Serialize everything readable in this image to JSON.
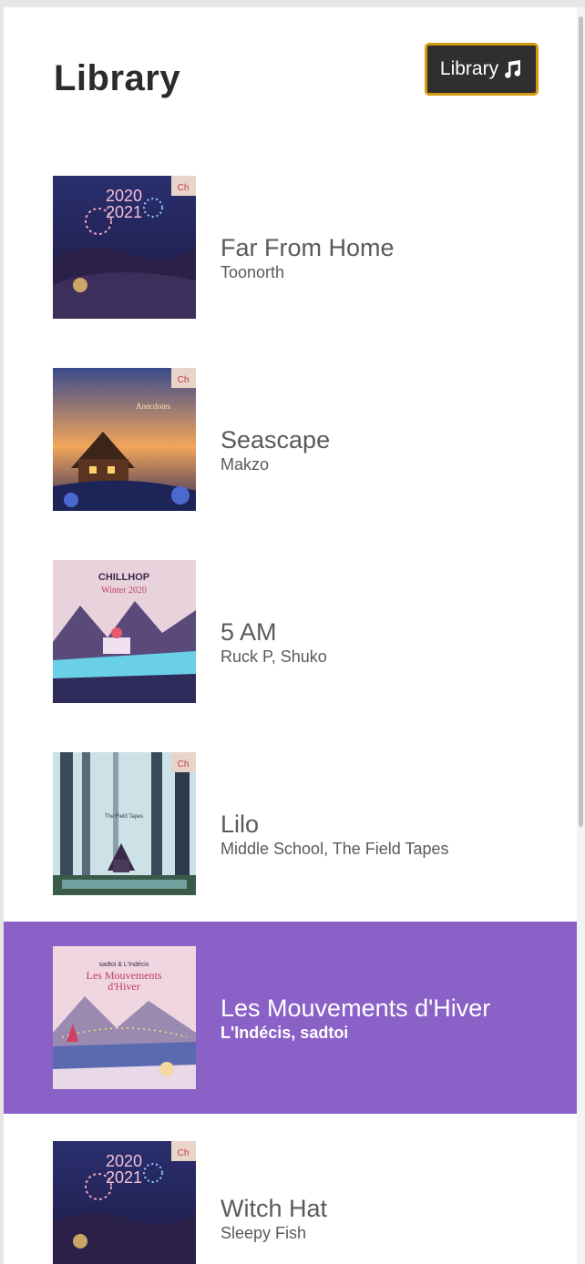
{
  "header": {
    "title": "Library",
    "library_button_label": "Library",
    "library_button_icon": "music-note-icon"
  },
  "colors": {
    "selected_row": "#8a61c6",
    "button_border": "#d59a10",
    "button_bg": "#2f2f2f",
    "text": "#5a5a5a"
  },
  "songs": [
    {
      "title": "Far From Home",
      "artist": "Toonorth",
      "selected": false
    },
    {
      "title": "Seascape",
      "artist": "Makzo",
      "selected": false
    },
    {
      "title": "5 AM",
      "artist": "Ruck P, Shuko",
      "selected": false
    },
    {
      "title": "Lilo",
      "artist": "Middle School, The Field Tapes",
      "selected": false
    },
    {
      "title": "Les Mouvements d'Hiver",
      "artist": "L'Indécis, sadtoi",
      "selected": true
    },
    {
      "title": "Witch Hat",
      "artist": "Sleepy Fish",
      "selected": false
    }
  ]
}
